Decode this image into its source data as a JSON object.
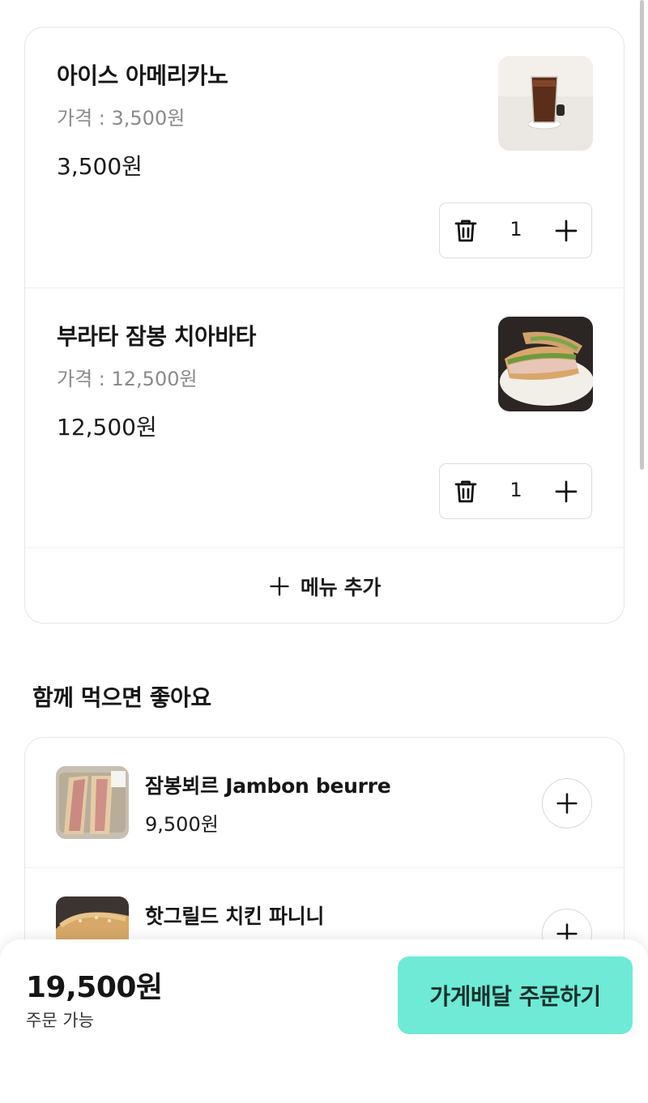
{
  "cart": {
    "items": [
      {
        "name": "아이스 아메리카노",
        "price_label": "가격 : 3,500원",
        "total": "3,500원",
        "quantity": "1",
        "image": "iced-americano-photo"
      },
      {
        "name": "부라타 잠봉 치아바타",
        "price_label": "가격 : 12,500원",
        "total": "12,500원",
        "quantity": "1",
        "image": "burrata-jambon-ciabatta-photo"
      }
    ],
    "add_menu_label": "메뉴 추가"
  },
  "recommend": {
    "title": "함께 먹으면 좋아요",
    "items": [
      {
        "name": "잠봉뵈르 Jambon beurre",
        "price": "9,500원",
        "image": "jambon-beurre-photo"
      },
      {
        "name": "핫그릴드 치킨 파니니",
        "price": "",
        "image": "hot-grilled-chicken-panini-photo"
      }
    ]
  },
  "footer": {
    "total": "19,500원",
    "status": "주문 가능",
    "order_button": "가게배달 주문하기"
  },
  "colors": {
    "accent": "#6eead6",
    "border": "#e6e6e6",
    "muted_text": "#8a8a8a"
  },
  "icons": [
    "trash-icon",
    "plus-icon",
    "circle-plus-icon"
  ]
}
